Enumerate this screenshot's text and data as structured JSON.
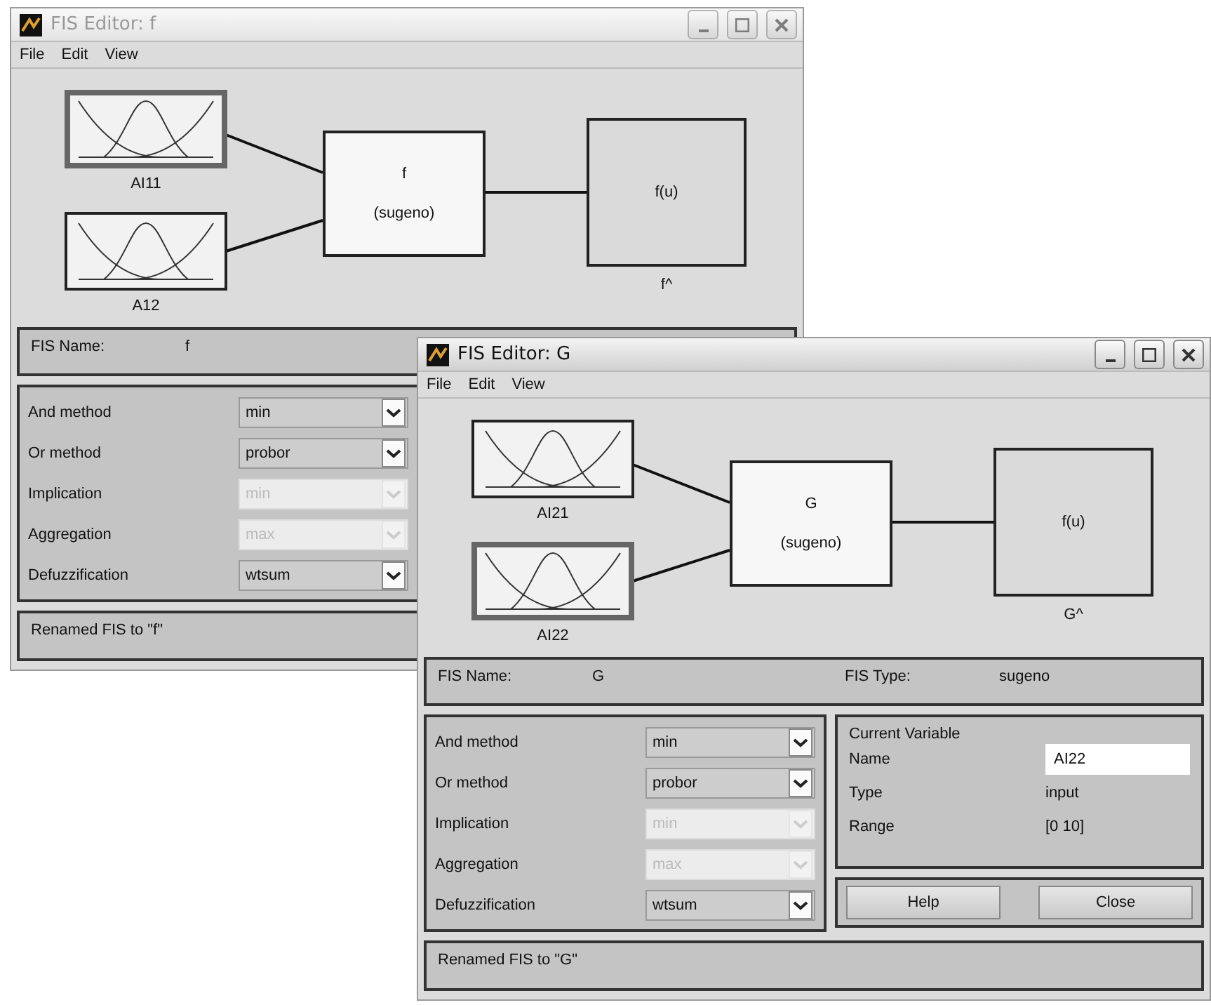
{
  "windows": [
    {
      "title": "FIS Editor: f",
      "active": false,
      "menu": [
        "File",
        "Edit",
        "View"
      ],
      "inputs": [
        {
          "label": "AI11",
          "selected": true
        },
        {
          "label": "A12",
          "selected": false
        }
      ],
      "system": {
        "name": "f",
        "type": "(sugeno)"
      },
      "output": {
        "func": "f(u)",
        "label": "f^"
      },
      "fis_name_label": "FIS Name:",
      "fis_name": "f",
      "methods": [
        {
          "label": "And method",
          "value": "min",
          "disabled": false
        },
        {
          "label": "Or method",
          "value": "probor",
          "disabled": false
        },
        {
          "label": "Implication",
          "value": "min",
          "disabled": true
        },
        {
          "label": "Aggregation",
          "value": "max",
          "disabled": true
        },
        {
          "label": "Defuzzification",
          "value": "wtsum",
          "disabled": false
        }
      ],
      "status": "Renamed FIS to \"f\""
    },
    {
      "title": "FIS Editor: G",
      "active": true,
      "menu": [
        "File",
        "Edit",
        "View"
      ],
      "inputs": [
        {
          "label": "AI21",
          "selected": false
        },
        {
          "label": "AI22",
          "selected": true
        }
      ],
      "system": {
        "name": "G",
        "type": "(sugeno)"
      },
      "output": {
        "func": "f(u)",
        "label": "G^"
      },
      "fis_name_label": "FIS Name:",
      "fis_name": "G",
      "fis_type_label": "FIS Type:",
      "fis_type": "sugeno",
      "methods": [
        {
          "label": "And method",
          "value": "min",
          "disabled": false
        },
        {
          "label": "Or method",
          "value": "probor",
          "disabled": false
        },
        {
          "label": "Implication",
          "value": "min",
          "disabled": true
        },
        {
          "label": "Aggregation",
          "value": "max",
          "disabled": true
        },
        {
          "label": "Defuzzification",
          "value": "wtsum",
          "disabled": false
        }
      ],
      "current_variable": {
        "title": "Current Variable",
        "rows": [
          {
            "label": "Name",
            "value": "AI22",
            "kind": "field"
          },
          {
            "label": "Type",
            "value": "input",
            "kind": "text"
          },
          {
            "label": "Range",
            "value": "[0 10]",
            "kind": "text"
          }
        ]
      },
      "buttons": [
        "Help",
        "Close"
      ],
      "status": "Renamed FIS to \"G\""
    }
  ]
}
